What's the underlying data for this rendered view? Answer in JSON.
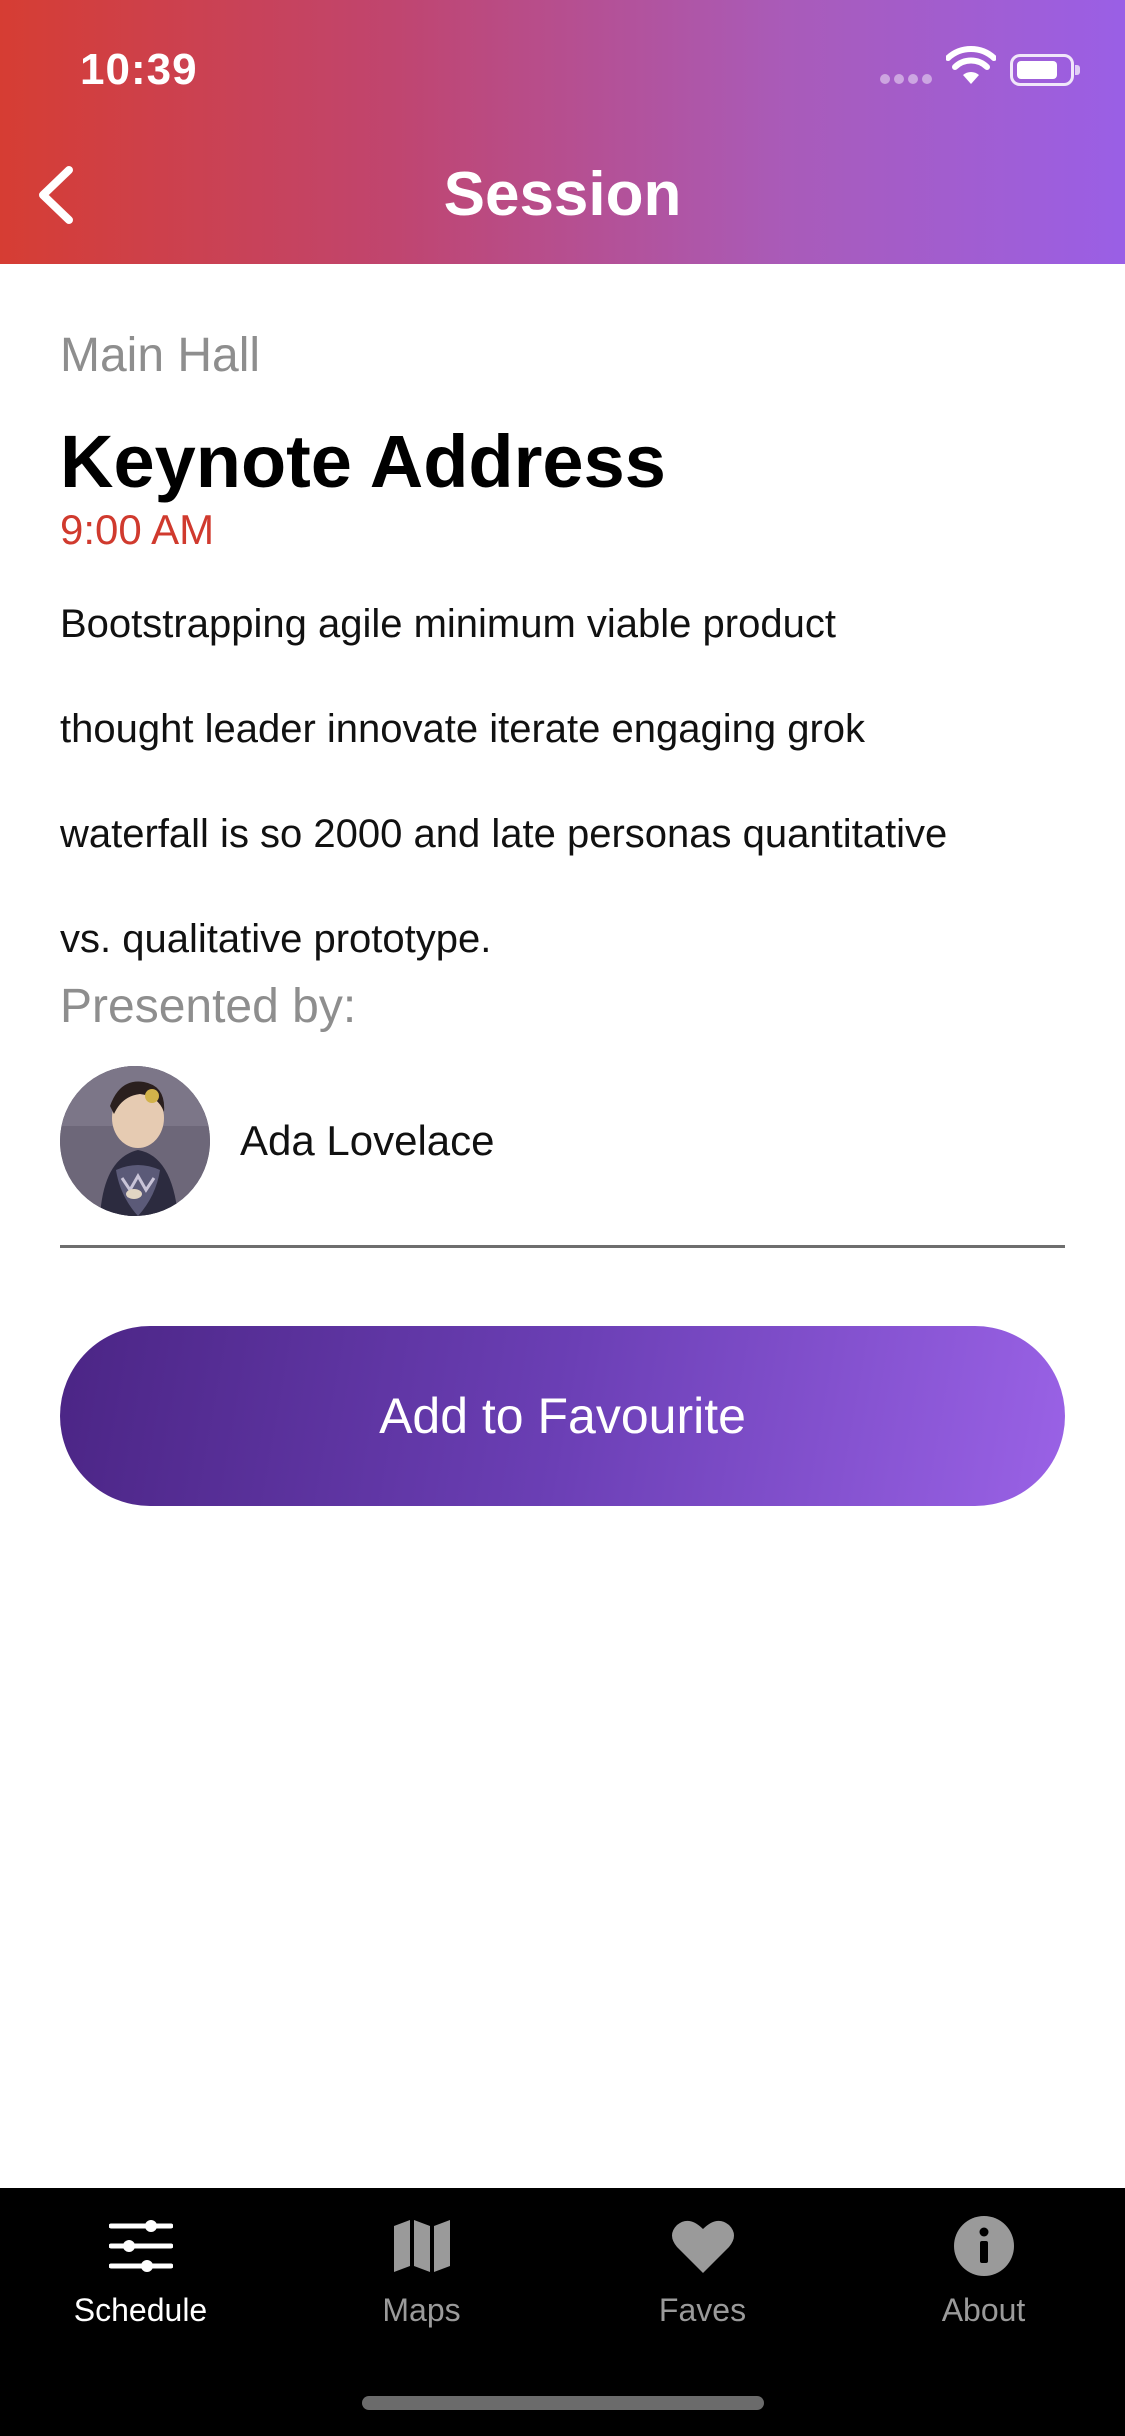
{
  "status_bar": {
    "time": "10:39"
  },
  "nav": {
    "title": "Session",
    "back_icon": "chevron-left-icon"
  },
  "session": {
    "room": "Main Hall",
    "title": "Keynote Address",
    "time": "9:00 AM",
    "description_lines": [
      "Bootstrapping agile minimum viable product",
      "thought leader innovate iterate engaging grok",
      "waterfall is so 2000 and late personas quantitative",
      "vs. qualitative prototype."
    ],
    "presented_by_label": "Presented by:"
  },
  "speaker": {
    "name": "Ada Lovelace"
  },
  "actions": {
    "favourite_label": "Add to Favourite"
  },
  "tabbar": {
    "tabs": [
      {
        "label": "Schedule",
        "icon": "sliders-icon",
        "active": true
      },
      {
        "label": "Maps",
        "icon": "map-icon",
        "active": false
      },
      {
        "label": "Faves",
        "icon": "heart-icon",
        "active": false
      },
      {
        "label": "About",
        "icon": "info-icon",
        "active": false
      }
    ]
  },
  "colors": {
    "header_gradient_start": "#d63d33",
    "header_gradient_end": "#9a5fe6",
    "time_accent": "#d03a2e",
    "button_gradient_start": "#4b2585",
    "button_gradient_end": "#9a62e6",
    "tabbar_background": "#000000"
  }
}
